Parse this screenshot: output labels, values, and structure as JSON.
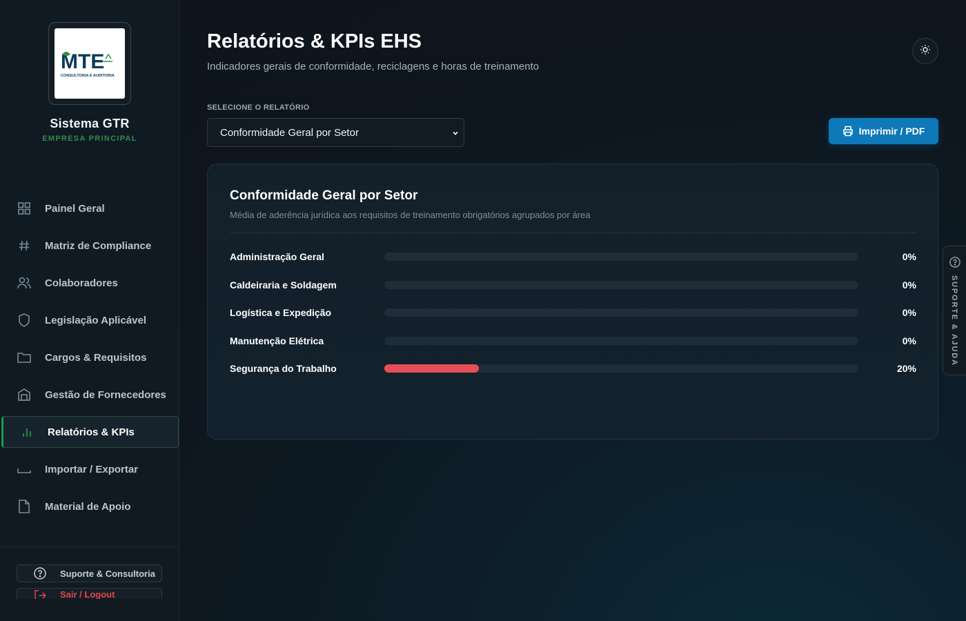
{
  "sidebar": {
    "logo": {
      "text": "MTE",
      "tagline": "CONSULTORIA E AUDITORIA"
    },
    "brand_name": "Sistema GTR",
    "brand_sub": "EMPRESA PRINCIPAL",
    "items": [
      {
        "label": "Painel Geral",
        "icon": "grid-icon"
      },
      {
        "label": "Matriz de Compliance",
        "icon": "hash-icon"
      },
      {
        "label": "Colaboradores",
        "icon": "users-icon"
      },
      {
        "label": "Legislação Aplicável",
        "icon": "shield-icon"
      },
      {
        "label": "Cargos & Requisitos",
        "icon": "folder-icon"
      },
      {
        "label": "Gestão de Fornecedores",
        "icon": "building-icon"
      },
      {
        "label": "Relatórios & KPIs",
        "icon": "bar-chart-icon",
        "active": true
      },
      {
        "label": "Importar / Exportar",
        "icon": "tray-icon"
      },
      {
        "label": "Material de Apoio",
        "icon": "file-icon"
      }
    ],
    "support_label": "Suporte & Consultoria",
    "logout_label": "Sair / Logout"
  },
  "header": {
    "title": "Relatórios & KPIs EHS",
    "subtitle": "Indicadores gerais de conformidade, reciclagens e horas de treinamento"
  },
  "report_select": {
    "label": "SELECIONE O RELATÓRIO",
    "value": "Conformidade Geral por Setor"
  },
  "print_button": "Imprimir / PDF",
  "card": {
    "title": "Conformidade Geral por Setor",
    "subtitle": "Média de aderência jurídica aos requisitos de treinamento obrigatórios agrupados por área",
    "rows": [
      {
        "label": "Administração Geral",
        "value": "0%",
        "fraction": 0
      },
      {
        "label": "Caldeiraria e Soldagem",
        "value": "0%",
        "fraction": 0
      },
      {
        "label": "Logística e Expedição",
        "value": "0%",
        "fraction": 0
      },
      {
        "label": "Manutenção Elétrica",
        "value": "0%",
        "fraction": 0
      },
      {
        "label": "Segurança do Trabalho",
        "value": "20%",
        "fraction": 0.2
      }
    ]
  },
  "help_tab": "SUPORTE & AJUDA",
  "colors": {
    "accent": "#0e78b8",
    "brand_green": "#1f9a4b",
    "bar_fill": "#e54e57"
  }
}
